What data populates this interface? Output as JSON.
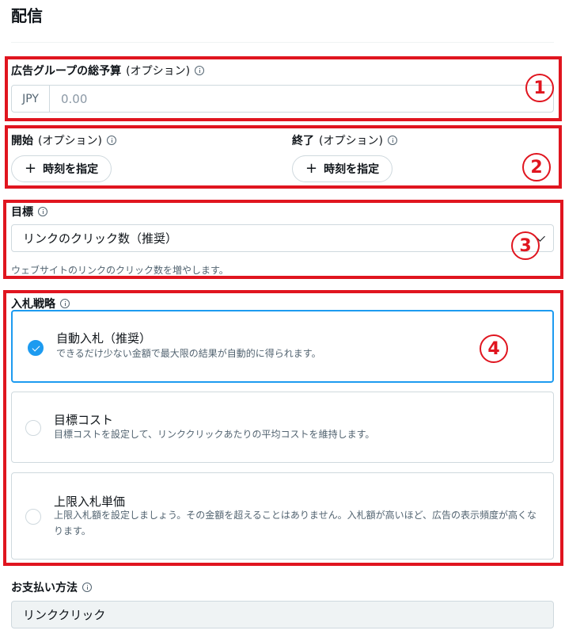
{
  "header": {
    "title": "配信"
  },
  "budget": {
    "label": "広告グループの総予算",
    "optional": "(オプション)",
    "currency": "JPY",
    "placeholder": "0.00"
  },
  "schedule": {
    "start_label": "開始",
    "end_label": "終了",
    "optional": "(オプション)",
    "start_button": "時刻を指定",
    "end_button": "時刻を指定"
  },
  "goal": {
    "label": "目標",
    "selected": "リンクのクリック数（推奨）",
    "helper": "ウェブサイトのリンクのクリック数を増やします。"
  },
  "bid": {
    "label": "入札戦略",
    "options": [
      {
        "title": "自動入札（推奨）",
        "desc": "できるだけ少ない金額で最大限の結果が自動的に得られます。",
        "selected": true
      },
      {
        "title": "目標コスト",
        "desc": "目標コストを設定して、リンククリックあたりの平均コストを維持します。",
        "selected": false
      },
      {
        "title": "上限入札単価",
        "desc": "上限入札額を設定しましょう。その金額を超えることはありません。入札額が高いほど、広告の表示頻度が高くなります。",
        "selected": false
      }
    ]
  },
  "payment": {
    "label": "お支払い方法",
    "value": "リンククリック"
  },
  "annotations": [
    "1",
    "2",
    "3",
    "4"
  ],
  "colors": {
    "accent": "#1d9bf0",
    "annotation": "#e0151f"
  }
}
